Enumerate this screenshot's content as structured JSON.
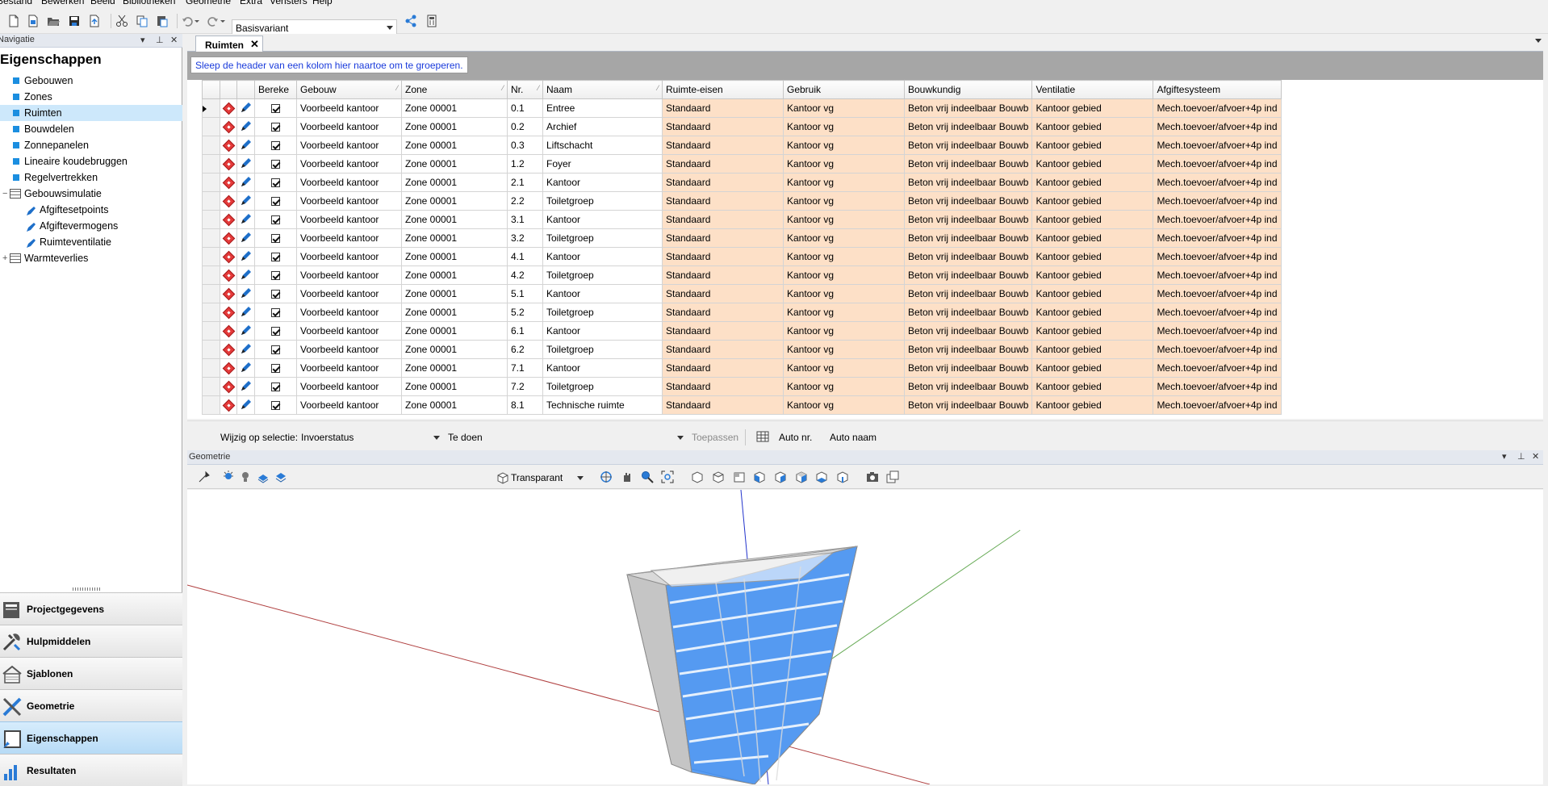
{
  "menu": [
    "Bestand",
    "Bewerken",
    "Beeld",
    "Bibliotheken",
    "Geometrie",
    "Extra",
    "Vensters",
    "Help"
  ],
  "toolbar": {
    "variant": "Basisvariant"
  },
  "navigation": {
    "header": "Navigatie",
    "title": "Eigenschappen",
    "items": [
      {
        "label": "Gebouwen"
      },
      {
        "label": "Zones"
      },
      {
        "label": "Ruimten",
        "selected": true
      },
      {
        "label": "Bouwdelen"
      },
      {
        "label": "Zonnepanelen"
      },
      {
        "label": "Lineaire koudebruggen"
      },
      {
        "label": "Regelvertrekken"
      },
      {
        "label": "Gebouwsimulatie"
      },
      {
        "label": "Afgiftesetpoints"
      },
      {
        "label": "Afgiftevermogens"
      },
      {
        "label": "Ruimteventilatie"
      },
      {
        "label": "Warmteverlies"
      }
    ],
    "buttons": [
      "Projectgegevens",
      "Hulpmiddelen",
      "Sjablonen",
      "Geometrie",
      "Eigenschappen",
      "Resultaten"
    ],
    "active_button": "Eigenschappen"
  },
  "tab": {
    "label": "Ruimten"
  },
  "group_hint": "Sleep de header van een kolom hier naartoe om te groeperen.",
  "columns": [
    "Bereke",
    "Gebouw",
    "Zone",
    "Nr.",
    "Naam",
    "Ruimte-eisen",
    "Gebruik",
    "Bouwkundig",
    "Ventilatie",
    "Afgiftesysteem"
  ],
  "rows": [
    {
      "gebouw": "Voorbeeld kantoor",
      "zone": "Zone 00001",
      "nr": "0.1",
      "naam": "Entree",
      "eisen": "Standaard",
      "gebruik": "Kantoor vg",
      "bouwkundig": "Beton vrij indeelbaar Bouwb",
      "ventilatie": "Kantoor gebied",
      "afgifte": "Mech.toevoer/afvoer+4p ind"
    },
    {
      "gebouw": "Voorbeeld kantoor",
      "zone": "Zone 00001",
      "nr": "0.2",
      "naam": "Archief",
      "eisen": "Standaard",
      "gebruik": "Kantoor vg",
      "bouwkundig": "Beton vrij indeelbaar Bouwb",
      "ventilatie": "Kantoor gebied",
      "afgifte": "Mech.toevoer/afvoer+4p ind"
    },
    {
      "gebouw": "Voorbeeld kantoor",
      "zone": "Zone 00001",
      "nr": "0.3",
      "naam": "Liftschacht",
      "eisen": "Standaard",
      "gebruik": "Kantoor vg",
      "bouwkundig": "Beton vrij indeelbaar Bouwb",
      "ventilatie": "Kantoor gebied",
      "afgifte": "Mech.toevoer/afvoer+4p ind"
    },
    {
      "gebouw": "Voorbeeld kantoor",
      "zone": "Zone 00001",
      "nr": "1.2",
      "naam": "Foyer",
      "eisen": "Standaard",
      "gebruik": "Kantoor vg",
      "bouwkundig": "Beton vrij indeelbaar Bouwb",
      "ventilatie": "Kantoor gebied",
      "afgifte": "Mech.toevoer/afvoer+4p ind"
    },
    {
      "gebouw": "Voorbeeld kantoor",
      "zone": "Zone 00001",
      "nr": "2.1",
      "naam": "Kantoor",
      "eisen": "Standaard",
      "gebruik": "Kantoor vg",
      "bouwkundig": "Beton vrij indeelbaar Bouwb",
      "ventilatie": "Kantoor gebied",
      "afgifte": "Mech.toevoer/afvoer+4p ind"
    },
    {
      "gebouw": "Voorbeeld kantoor",
      "zone": "Zone 00001",
      "nr": "2.2",
      "naam": "Toiletgroep",
      "eisen": "Standaard",
      "gebruik": "Kantoor vg",
      "bouwkundig": "Beton vrij indeelbaar Bouwb",
      "ventilatie": "Kantoor gebied",
      "afgifte": "Mech.toevoer/afvoer+4p ind"
    },
    {
      "gebouw": "Voorbeeld kantoor",
      "zone": "Zone 00001",
      "nr": "3.1",
      "naam": "Kantoor",
      "eisen": "Standaard",
      "gebruik": "Kantoor vg",
      "bouwkundig": "Beton vrij indeelbaar Bouwb",
      "ventilatie": "Kantoor gebied",
      "afgifte": "Mech.toevoer/afvoer+4p ind"
    },
    {
      "gebouw": "Voorbeeld kantoor",
      "zone": "Zone 00001",
      "nr": "3.2",
      "naam": "Toiletgroep",
      "eisen": "Standaard",
      "gebruik": "Kantoor vg",
      "bouwkundig": "Beton vrij indeelbaar Bouwb",
      "ventilatie": "Kantoor gebied",
      "afgifte": "Mech.toevoer/afvoer+4p ind"
    },
    {
      "gebouw": "Voorbeeld kantoor",
      "zone": "Zone 00001",
      "nr": "4.1",
      "naam": "Kantoor",
      "eisen": "Standaard",
      "gebruik": "Kantoor vg",
      "bouwkundig": "Beton vrij indeelbaar Bouwb",
      "ventilatie": "Kantoor gebied",
      "afgifte": "Mech.toevoer/afvoer+4p ind"
    },
    {
      "gebouw": "Voorbeeld kantoor",
      "zone": "Zone 00001",
      "nr": "4.2",
      "naam": "Toiletgroep",
      "eisen": "Standaard",
      "gebruik": "Kantoor vg",
      "bouwkundig": "Beton vrij indeelbaar Bouwb",
      "ventilatie": "Kantoor gebied",
      "afgifte": "Mech.toevoer/afvoer+4p ind"
    },
    {
      "gebouw": "Voorbeeld kantoor",
      "zone": "Zone 00001",
      "nr": "5.1",
      "naam": "Kantoor",
      "eisen": "Standaard",
      "gebruik": "Kantoor vg",
      "bouwkundig": "Beton vrij indeelbaar Bouwb",
      "ventilatie": "Kantoor gebied",
      "afgifte": "Mech.toevoer/afvoer+4p ind"
    },
    {
      "gebouw": "Voorbeeld kantoor",
      "zone": "Zone 00001",
      "nr": "5.2",
      "naam": "Toiletgroep",
      "eisen": "Standaard",
      "gebruik": "Kantoor vg",
      "bouwkundig": "Beton vrij indeelbaar Bouwb",
      "ventilatie": "Kantoor gebied",
      "afgifte": "Mech.toevoer/afvoer+4p ind"
    },
    {
      "gebouw": "Voorbeeld kantoor",
      "zone": "Zone 00001",
      "nr": "6.1",
      "naam": "Kantoor",
      "eisen": "Standaard",
      "gebruik": "Kantoor vg",
      "bouwkundig": "Beton vrij indeelbaar Bouwb",
      "ventilatie": "Kantoor gebied",
      "afgifte": "Mech.toevoer/afvoer+4p ind"
    },
    {
      "gebouw": "Voorbeeld kantoor",
      "zone": "Zone 00001",
      "nr": "6.2",
      "naam": "Toiletgroep",
      "eisen": "Standaard",
      "gebruik": "Kantoor vg",
      "bouwkundig": "Beton vrij indeelbaar Bouwb",
      "ventilatie": "Kantoor gebied",
      "afgifte": "Mech.toevoer/afvoer+4p ind"
    },
    {
      "gebouw": "Voorbeeld kantoor",
      "zone": "Zone 00001",
      "nr": "7.1",
      "naam": "Kantoor",
      "eisen": "Standaard",
      "gebruik": "Kantoor vg",
      "bouwkundig": "Beton vrij indeelbaar Bouwb",
      "ventilatie": "Kantoor gebied",
      "afgifte": "Mech.toevoer/afvoer+4p ind"
    },
    {
      "gebouw": "Voorbeeld kantoor",
      "zone": "Zone 00001",
      "nr": "7.2",
      "naam": "Toiletgroep",
      "eisen": "Standaard",
      "gebruik": "Kantoor vg",
      "bouwkundig": "Beton vrij indeelbaar Bouwb",
      "ventilatie": "Kantoor gebied",
      "afgifte": "Mech.toevoer/afvoer+4p ind"
    },
    {
      "gebouw": "Voorbeeld kantoor",
      "zone": "Zone 00001",
      "nr": "8.1",
      "naam": "Technische ruimte",
      "eisen": "Standaard",
      "gebruik": "Kantoor vg",
      "bouwkundig": "Beton vrij indeelbaar Bouwb",
      "ventilatie": "Kantoor gebied",
      "afgifte": "Mech.toevoer/afvoer+4p ind"
    }
  ],
  "selection_bar": {
    "label": "Wijzig op selectie:",
    "field": "Invoerstatus",
    "value": "Te doen",
    "apply": "Toepassen",
    "auto_nr": "Auto nr.",
    "auto_naam": "Auto naam"
  },
  "geometry": {
    "header": "Geometrie",
    "view_mode": "Transparant"
  },
  "colors": {
    "highlight_cells": "#fde0c7",
    "selection": "#cde8fb",
    "building_glass": "#3d8ef5"
  }
}
